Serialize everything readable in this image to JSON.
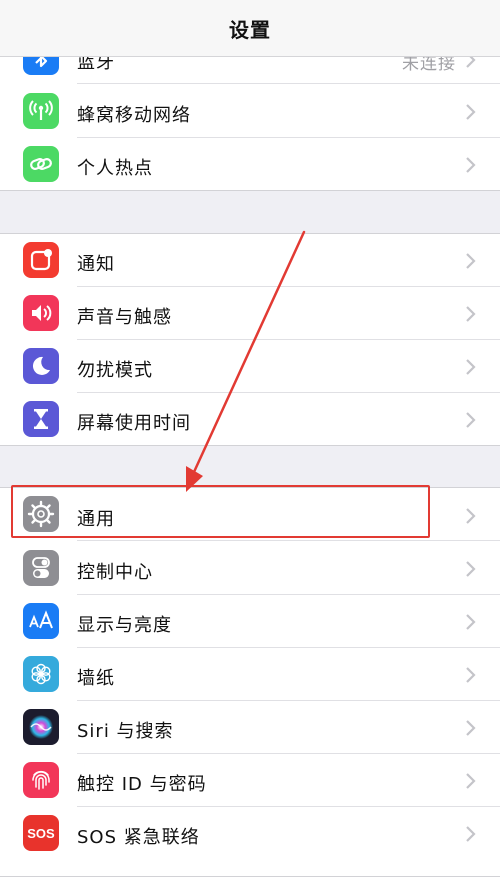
{
  "nav": {
    "title": "设置"
  },
  "group1": [
    {
      "label": "蓝牙",
      "value": "未连接",
      "icon": "bluetooth-icon",
      "color": "#1a7cf5"
    },
    {
      "label": "蜂窝移动网络",
      "icon": "cellular-antenna-icon",
      "color": "#4cd964"
    },
    {
      "label": "个人热点",
      "icon": "hotspot-chain-icon",
      "color": "#4cd964"
    }
  ],
  "group2": [
    {
      "label": "通知",
      "icon": "notification-icon",
      "color": "#f33b30"
    },
    {
      "label": "声音与触感",
      "icon": "speaker-icon",
      "color": "#f23659"
    },
    {
      "label": "勿扰模式",
      "icon": "moon-icon",
      "color": "#5b58d6"
    },
    {
      "label": "屏幕使用时间",
      "icon": "hourglass-icon",
      "color": "#5b58d6"
    }
  ],
  "group3": [
    {
      "label": "通用",
      "icon": "gear-icon",
      "color": "#8e8e93"
    },
    {
      "label": "控制中心",
      "icon": "toggle-switches-icon",
      "color": "#8e8e93"
    },
    {
      "label": "显示与亮度",
      "icon": "text-size-aa-icon",
      "color": "#1a7cf5"
    },
    {
      "label": "墙纸",
      "icon": "flower-icon",
      "color": "#35aadc"
    },
    {
      "label": "Siri 与搜索",
      "icon": "siri-icon",
      "color": "#1c1c2e"
    },
    {
      "label": "触控 ID 与密码",
      "icon": "fingerprint-icon",
      "color": "#f23659"
    },
    {
      "label": "SOS 紧急联络",
      "icon": "sos-icon",
      "color": "#e8332c"
    }
  ],
  "sos_icon_text": "SOS",
  "annotation": {
    "highlight_color": "#e23a33"
  }
}
